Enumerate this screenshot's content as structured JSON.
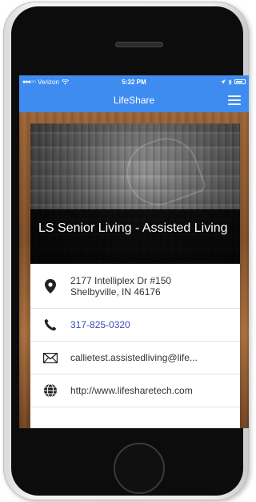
{
  "status_bar": {
    "signal": "●●●○○",
    "carrier": "Verizon",
    "wifi_icon": "wifi-icon",
    "time": "5:32 PM",
    "battery_icon": "battery-icon"
  },
  "app_bar": {
    "title": "LifeShare",
    "menu_icon": "hamburger-menu-icon"
  },
  "listing": {
    "title": "LS Senior Living - Assisted Living",
    "address_line1": "2177 Intelliplex Dr #150",
    "address_line2": "Shelbyville, IN 46176",
    "phone": "317-825-0320",
    "email": "callietest.assistedliving@life...",
    "website": "http://www.lifesharetech.com"
  },
  "colors": {
    "header_blue": "#3f8cf0",
    "link_blue": "#3d4bb5"
  }
}
